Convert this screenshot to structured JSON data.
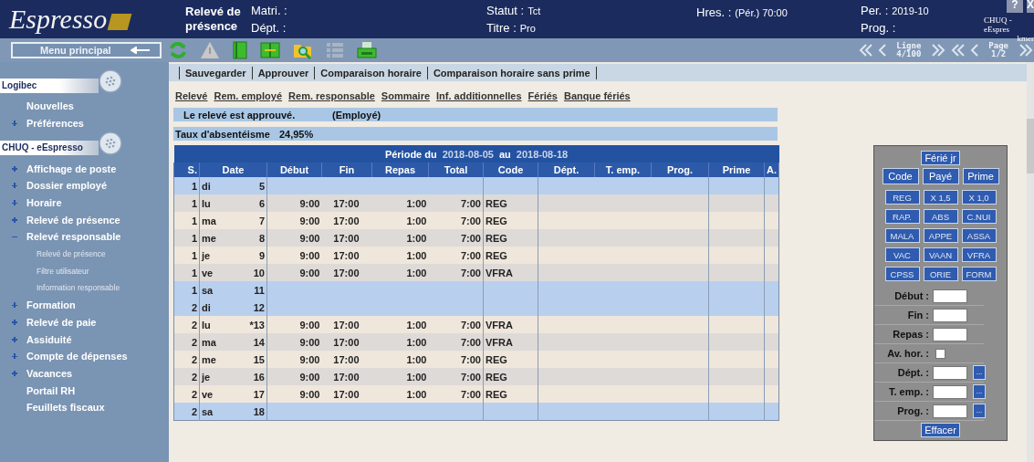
{
  "header": {
    "logo": "Espresso",
    "title": "Relevé de présence",
    "columns": [
      [
        {
          "label": "Matri. :"
        },
        {
          "label": "Dépt. :"
        }
      ],
      [
        {
          "label": "Statut :",
          "value": "Tct"
        },
        {
          "label": "Titre :",
          "value": "Pro"
        }
      ],
      [
        {
          "label": "Hres. :",
          "value": "(Pér.) 70:00"
        }
      ],
      [
        {
          "label": "Per. :",
          "value": "2019-10"
        },
        {
          "label": "Prog. :"
        }
      ]
    ],
    "help_button": "?",
    "close_button": "X",
    "site": "CHUQ - eEspres",
    "user": "kmer"
  },
  "toolbar": {
    "menu_button": "Menu principal",
    "line_label": "Ligne",
    "line_value": "4/100",
    "page_label": "Page",
    "page_value": "1/2"
  },
  "sidebar": {
    "sections": [
      {
        "title": "Logibec",
        "items": [
          {
            "label": "Nouvelles"
          },
          {
            "label": "Préférences",
            "expanded": false
          }
        ]
      },
      {
        "title": "CHUQ - eEspresso",
        "items": [
          {
            "label": "Affichage de poste",
            "expanded": false
          },
          {
            "label": "Dossier employé",
            "expanded": false
          },
          {
            "label": "Horaire",
            "expanded": false
          },
          {
            "label": "Relevé de présence",
            "expanded": false
          },
          {
            "label": "Relevé responsable",
            "expanded": true,
            "children": [
              {
                "label": "Relevé de présence"
              },
              {
                "label": "Filtre utilisateur"
              },
              {
                "label": "Information responsable"
              }
            ]
          },
          {
            "label": "Formation",
            "expanded": false
          },
          {
            "label": "Relevé de paie",
            "expanded": false
          },
          {
            "label": "Assiduité",
            "expanded": false
          },
          {
            "label": "Compte de dépenses",
            "expanded": false
          },
          {
            "label": "Vacances",
            "expanded": false
          },
          {
            "label": "Portail RH"
          },
          {
            "label": "Feuillets fiscaux"
          }
        ]
      }
    ]
  },
  "actions": [
    "Sauvegarder",
    "Approuver",
    "Comparaison horaire",
    "Comparaison horaire sans prime"
  ],
  "links": [
    "Relevé",
    "Rem. employé",
    "Rem. responsable",
    "Sommaire",
    "Inf. additionnelles",
    "Fériés",
    "Banque fériés"
  ],
  "status": {
    "message": "Le relevé est approuvé.",
    "by": "(Employé)"
  },
  "absence": {
    "label": "Taux d'absentéisme",
    "value": "24,95%"
  },
  "table": {
    "period": {
      "label": "Période du",
      "start": "2018-08-05",
      "sep": "au",
      "end": "2018-08-18"
    },
    "columns": [
      "S.",
      "Date",
      "Début",
      "Fin",
      "Repas",
      "Total",
      "Code",
      "Dépt.",
      "T. emp.",
      "Prog.",
      "Prime",
      "A."
    ],
    "rows": [
      {
        "s": "1",
        "day": "di",
        "date": "5",
        "weekend": true
      },
      {
        "s": "1",
        "day": "lu",
        "date": "6",
        "start": "9:00",
        "end": "17:00",
        "meal": "1:00",
        "total": "7:00",
        "code": "REG",
        "weekend": false
      },
      {
        "s": "1",
        "day": "ma",
        "date": "7",
        "start": "9:00",
        "end": "17:00",
        "meal": "1:00",
        "total": "7:00",
        "code": "REG",
        "weekend": false
      },
      {
        "s": "1",
        "day": "me",
        "date": "8",
        "start": "9:00",
        "end": "17:00",
        "meal": "1:00",
        "total": "7:00",
        "code": "REG",
        "weekend": false
      },
      {
        "s": "1",
        "day": "je",
        "date": "9",
        "start": "9:00",
        "end": "17:00",
        "meal": "1:00",
        "total": "7:00",
        "code": "REG",
        "weekend": false
      },
      {
        "s": "1",
        "day": "ve",
        "date": "10",
        "start": "9:00",
        "end": "17:00",
        "meal": "1:00",
        "total": "7:00",
        "code": "VFRA",
        "weekend": false
      },
      {
        "s": "1",
        "day": "sa",
        "date": "11",
        "weekend": true
      },
      {
        "s": "2",
        "day": "di",
        "date": "12",
        "weekend": true
      },
      {
        "s": "2",
        "day": "lu",
        "date": "*13",
        "start": "9:00",
        "end": "17:00",
        "meal": "1:00",
        "total": "7:00",
        "code": "VFRA",
        "weekend": false
      },
      {
        "s": "2",
        "day": "ma",
        "date": "14",
        "start": "9:00",
        "end": "17:00",
        "meal": "1:00",
        "total": "7:00",
        "code": "VFRA",
        "weekend": false
      },
      {
        "s": "2",
        "day": "me",
        "date": "15",
        "start": "9:00",
        "end": "17:00",
        "meal": "1:00",
        "total": "7:00",
        "code": "REG",
        "weekend": false
      },
      {
        "s": "2",
        "day": "je",
        "date": "16",
        "start": "9:00",
        "end": "17:00",
        "meal": "1:00",
        "total": "7:00",
        "code": "REG",
        "weekend": false
      },
      {
        "s": "2",
        "day": "ve",
        "date": "17",
        "start": "9:00",
        "end": "17:00",
        "meal": "1:00",
        "total": "7:00",
        "code": "REG",
        "weekend": false
      },
      {
        "s": "2",
        "day": "sa",
        "date": "18",
        "weekend": true
      }
    ]
  },
  "panel": {
    "holiday_button": "Férié jr",
    "tabs": [
      "Code",
      "Payé",
      "Prime"
    ],
    "codes": [
      "REG",
      "X 1,5",
      "X 1,0",
      "RAP.",
      "ABS",
      "C.NUI",
      "MALA",
      "APPE",
      "ASSA",
      "VAC",
      "VAAN",
      "VFRA",
      "CPSS",
      "ORIE",
      "FORM"
    ],
    "fields": [
      {
        "kind": "text",
        "label": "Début :"
      },
      {
        "kind": "text",
        "label": "Fin :"
      },
      {
        "kind": "text",
        "label": "Repas :"
      },
      {
        "kind": "checkbox",
        "label": "Av. hor. :",
        "checked": false
      },
      {
        "kind": "lookup",
        "label": "Dépt. :",
        "button": "..."
      },
      {
        "kind": "lookup",
        "label": "T. emp. :",
        "button": "..."
      },
      {
        "kind": "lookup",
        "label": "Prog. :",
        "button": "..."
      }
    ],
    "clear_button": "Effacer"
  }
}
